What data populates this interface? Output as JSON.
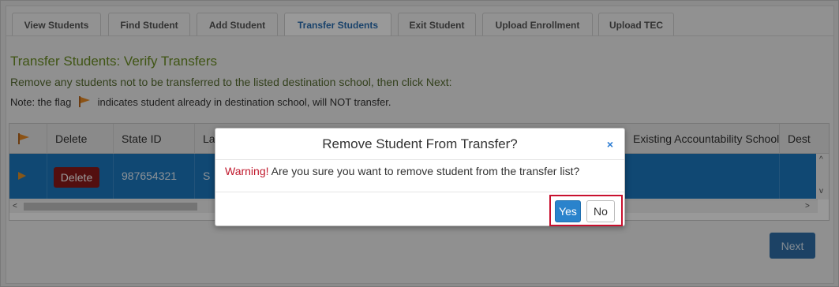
{
  "tabs": [
    {
      "label": "View Students",
      "active": false
    },
    {
      "label": "Find Student",
      "active": false
    },
    {
      "label": "Add Student",
      "active": false
    },
    {
      "label": "Transfer Students",
      "active": true
    },
    {
      "label": "Exit Student",
      "active": false
    },
    {
      "label": "Upload Enrollment",
      "active": false
    },
    {
      "label": "Upload TEC",
      "active": false
    }
  ],
  "page": {
    "heading": "Transfer Students: Verify Transfers",
    "instruction": "Remove any students not to be transferred to the listed destination school, then click Next:",
    "note_prefix": "Note: the flag",
    "note_suffix": "indicates student already in destination school, will NOT transfer.",
    "flag_icon": "flag-icon"
  },
  "grid": {
    "columns": [
      "Delete",
      "State ID",
      "La",
      "Existing Accountability School",
      "Dest"
    ],
    "rows": [
      {
        "flag": "flag-icon",
        "delete_label": "Delete",
        "state_id": "987654321",
        "last_name_fragment": "S"
      }
    ]
  },
  "next_label": "Next",
  "modal": {
    "title": "Remove Student From Transfer?",
    "close": "×",
    "warning_label": "Warning!",
    "message": " Are you sure you want to remove student from the transfer list?",
    "yes_label": "Yes",
    "no_label": "No"
  },
  "colors": {
    "heading": "#6b8e23",
    "selected_row": "#1c79c0",
    "delete_button": "#8b1a1a",
    "warning": "#c0182c",
    "yes_button": "#2a83cc",
    "highlight_box": "#c8102e"
  }
}
